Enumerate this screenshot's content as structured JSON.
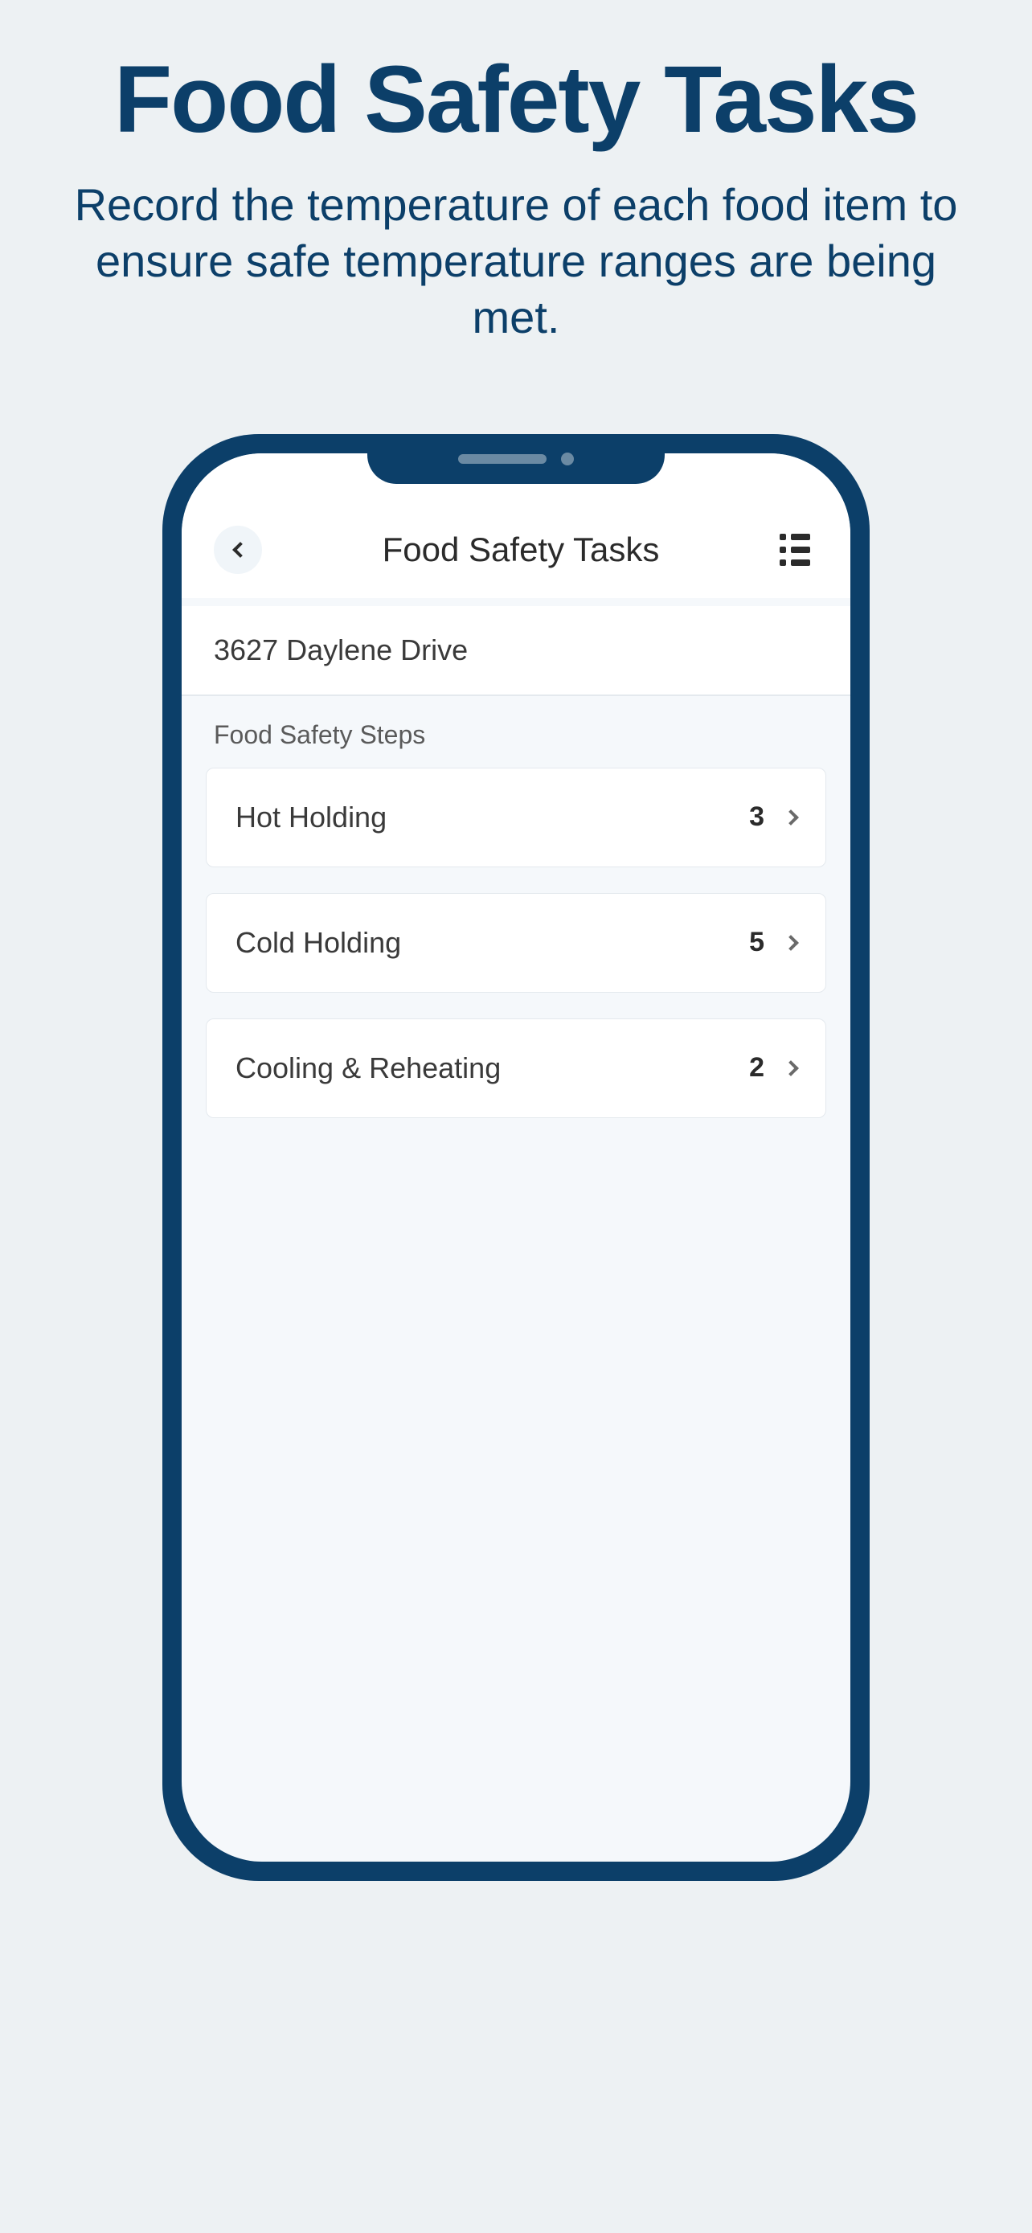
{
  "page": {
    "title": "Food Safety Tasks",
    "subtitle": "Record the temperature of each food item to ensure safe temperature ranges are being met."
  },
  "app": {
    "header_title": "Food Safety Tasks",
    "location": "3627 Daylene Drive",
    "section_label": "Food Safety Steps",
    "steps": [
      {
        "label": "Hot Holding",
        "count": "3"
      },
      {
        "label": "Cold Holding",
        "count": "5"
      },
      {
        "label": "Cooling & Reheating",
        "count": "2"
      }
    ]
  }
}
